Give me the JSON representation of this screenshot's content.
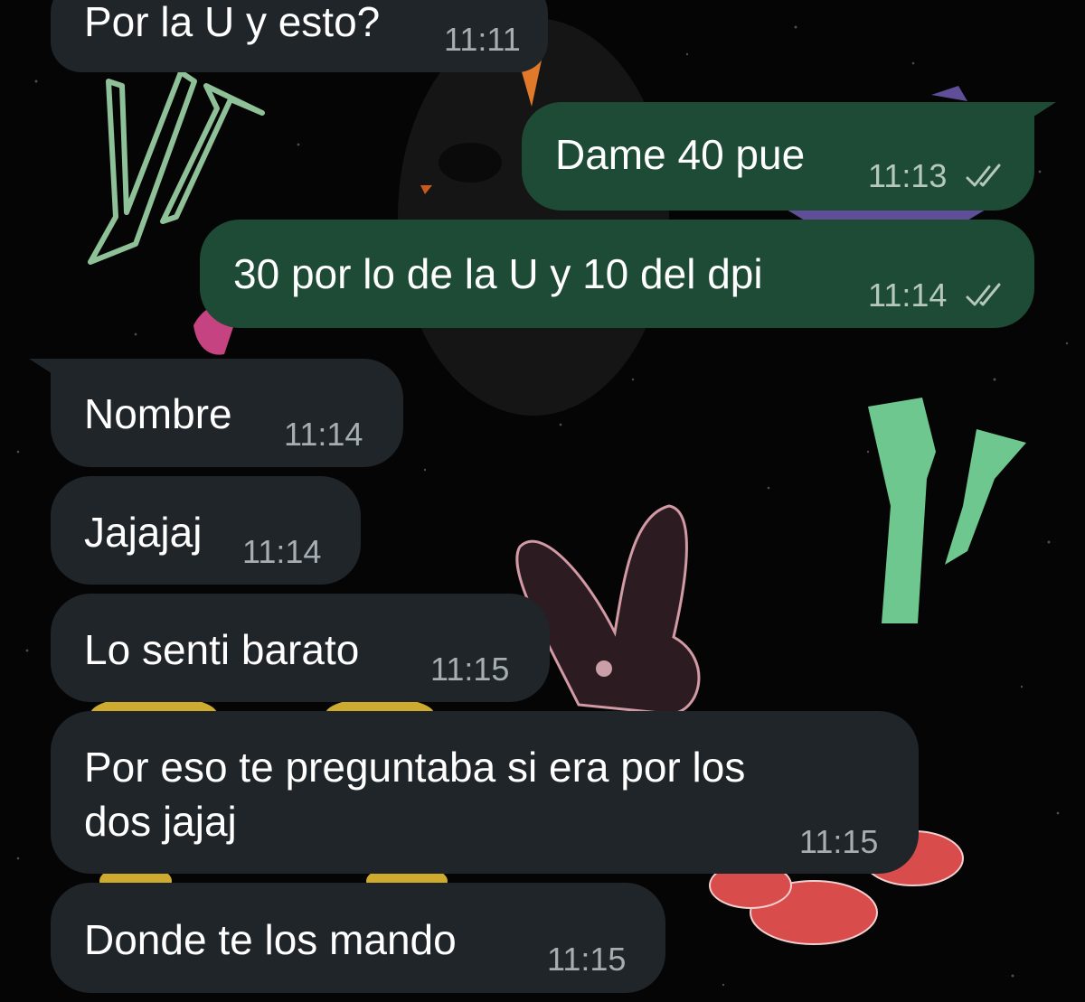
{
  "messages": [
    {
      "direction": "in",
      "text": "Por la U y esto?",
      "time": "11:11"
    },
    {
      "direction": "out",
      "text": "Dame 40 pue",
      "time": "11:13",
      "status_icon": "double-check-icon"
    },
    {
      "direction": "out",
      "text": "30 por lo de la U y 10 del dpi",
      "time": "11:14",
      "status_icon": "double-check-icon"
    },
    {
      "direction": "in",
      "text": "Nombre",
      "time": "11:14"
    },
    {
      "direction": "in",
      "text": "Jajajaj",
      "time": "11:14"
    },
    {
      "direction": "in",
      "text": "Lo senti barato",
      "time": "11:15"
    },
    {
      "direction": "in",
      "lines": [
        "Por eso te preguntaba si era por los",
        "dos jajaj"
      ],
      "time": "11:15"
    },
    {
      "direction": "in",
      "text": "Donde te los mando",
      "time": "11:15"
    }
  ],
  "colors": {
    "incoming_bubble": "#202529",
    "outgoing_bubble": "#1d4b35",
    "text": "#ffffff",
    "timestamp": "#a6aeb3",
    "wallpaper": "#050505"
  }
}
